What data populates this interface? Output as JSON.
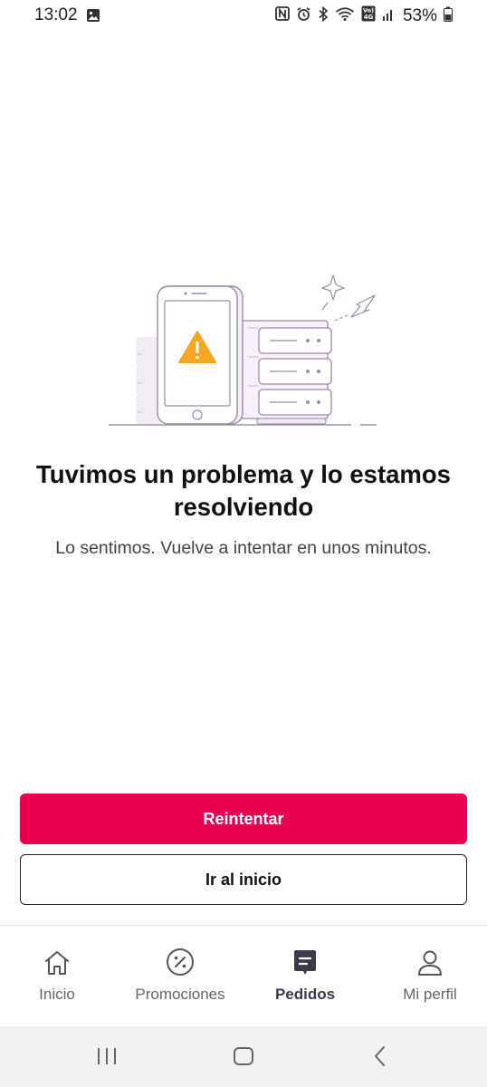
{
  "status_bar": {
    "time": "13:02",
    "battery": "53%",
    "icons": [
      "gallery-icon",
      "nfc-icon",
      "alarm-icon",
      "bluetooth-icon",
      "wifi-icon",
      "volte-icon",
      "signal-icon",
      "battery-icon"
    ],
    "volte_text": "Vo) 4G"
  },
  "error": {
    "title": "Tuvimos un problema y lo estamos resolviendo",
    "message": "Lo sentimos. Vuelve a intentar en unos minutos.",
    "illustration": "phone-server-warning-illustration"
  },
  "actions": {
    "retry_label": "Reintentar",
    "home_label": "Ir al inicio"
  },
  "bottom_nav": {
    "items": [
      {
        "label": "Inicio",
        "icon": "home-icon",
        "active": false
      },
      {
        "label": "Promociones",
        "icon": "percent-icon",
        "active": false
      },
      {
        "label": "Pedidos",
        "icon": "orders-icon",
        "active": true
      },
      {
        "label": "Mi perfil",
        "icon": "profile-icon",
        "active": false
      }
    ]
  },
  "system_nav": {
    "buttons": [
      "recents-icon",
      "home-button-icon",
      "back-icon"
    ]
  },
  "colors": {
    "primary": "#ea0050",
    "warning": "#f5a623",
    "illustration_stroke": "#9c8aa8",
    "illustration_fill": "#f3eef6"
  }
}
